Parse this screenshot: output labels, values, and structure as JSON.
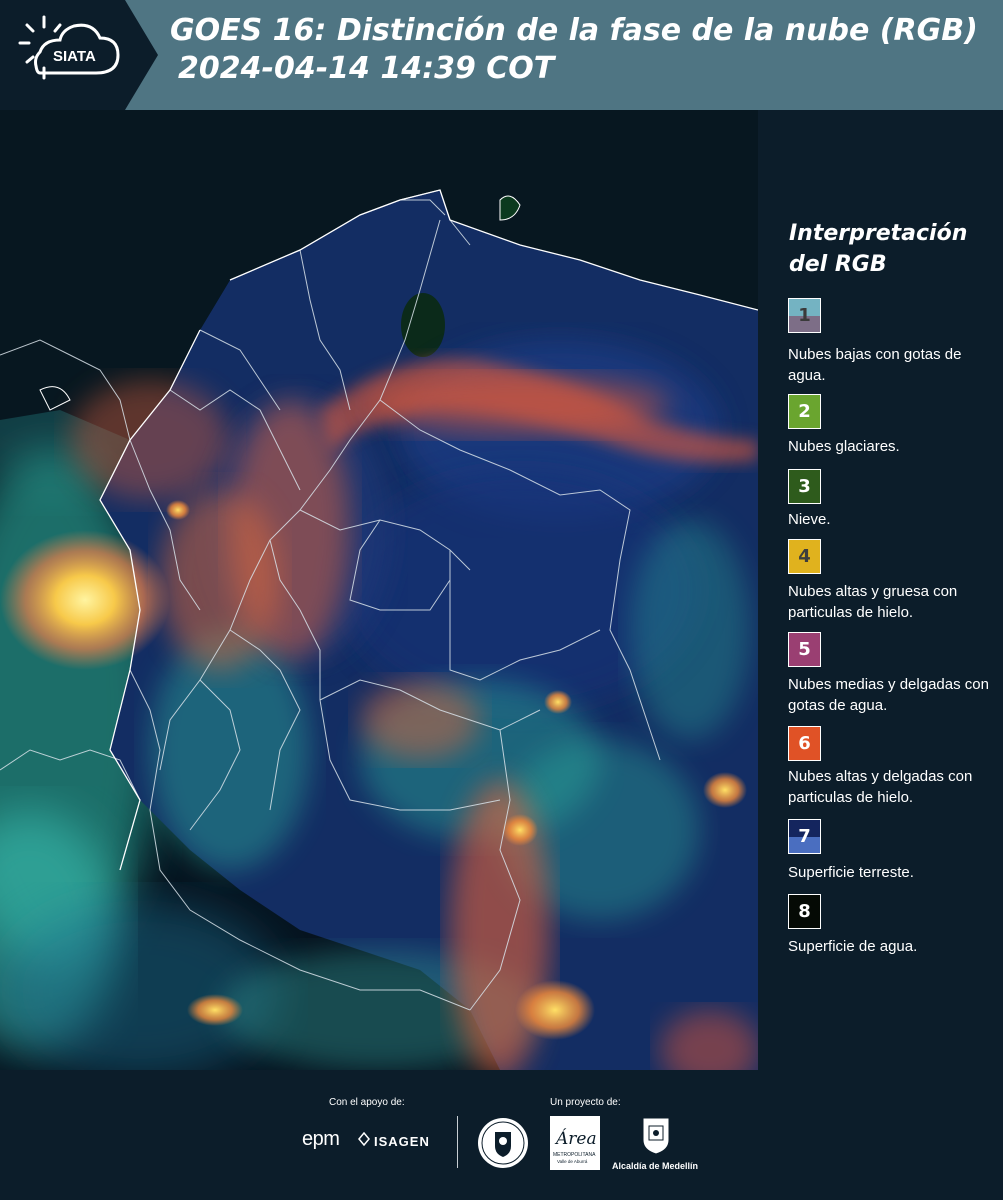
{
  "header": {
    "logo_text": "SIATA",
    "title_line1": "GOES 16: Distinción de la fase de la nube (RGB)",
    "title_line2": "2024-04-14 14:39 COT"
  },
  "legend": {
    "title": "Interpretación del RGB",
    "items": [
      {
        "number": "1",
        "label": "Nubes bajas con gotas de agua.",
        "color_top": "#74b3c2",
        "color_bottom": "#7d6e87"
      },
      {
        "number": "2",
        "label": "Nubes glaciares.",
        "color": "#6aa52f"
      },
      {
        "number": "3",
        "label": "Nieve.",
        "color": "#2e5b1c"
      },
      {
        "number": "4",
        "label": "Nubes altas y gruesa con particulas de hielo.",
        "color": "#e0b21e"
      },
      {
        "number": "5",
        "label": "Nubes medias y delgadas con gotas de agua.",
        "color": "#9a3f72"
      },
      {
        "number": "6",
        "label": "Nubes altas y delgadas con particulas de hielo.",
        "color": "#e05226"
      },
      {
        "number": "7",
        "label": "Superficie terreste.",
        "color_top": "#14255e",
        "color_bottom": "#4a6ec0"
      },
      {
        "number": "8",
        "label": "Superficie de agua.",
        "color": "#050a05"
      }
    ]
  },
  "footer": {
    "support_label": "Con el apoyo de:",
    "project_label": "Un proyecto de:",
    "sponsor_epm": "epm",
    "sponsor_isagen": "ISAGEN",
    "area_logo_text": "Área",
    "area_logo_sub": "METROPOLITANA",
    "area_logo_sub2": "Valle de Aburrá",
    "alcaldia": "Alcaldía de Medellín"
  }
}
